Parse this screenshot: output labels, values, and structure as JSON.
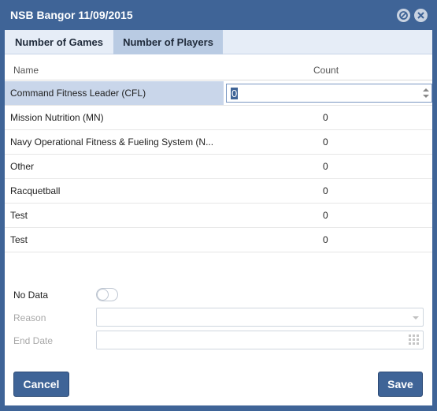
{
  "window": {
    "title": "NSB Bangor 11/09/2015",
    "minimize_icon": "minimize-icon",
    "close_icon": "close-icon"
  },
  "tabs": [
    {
      "label": "Number of Games",
      "selected": false
    },
    {
      "label": "Number of Players",
      "selected": true
    }
  ],
  "grid": {
    "columns": {
      "name": "Name",
      "count": "Count"
    },
    "rows": [
      {
        "name": "Command Fitness Leader (CFL)",
        "count": "0",
        "editing": true
      },
      {
        "name": "Mission Nutrition (MN)",
        "count": "0"
      },
      {
        "name": "Navy Operational Fitness & Fueling System (N...",
        "count": "0"
      },
      {
        "name": "Other",
        "count": "0"
      },
      {
        "name": "Racquetball",
        "count": "0"
      },
      {
        "name": "Test",
        "count": "0"
      },
      {
        "name": "Test",
        "count": "0"
      }
    ]
  },
  "form": {
    "no_data_label": "No Data",
    "no_data_value": false,
    "reason_label": "Reason",
    "reason_value": "",
    "end_date_label": "End Date",
    "end_date_value": ""
  },
  "buttons": {
    "cancel": "Cancel",
    "save": "Save"
  },
  "colors": {
    "accent": "#3f6497",
    "tab_selected": "#b9cbe3",
    "row_selected": "#c9d6ea"
  }
}
